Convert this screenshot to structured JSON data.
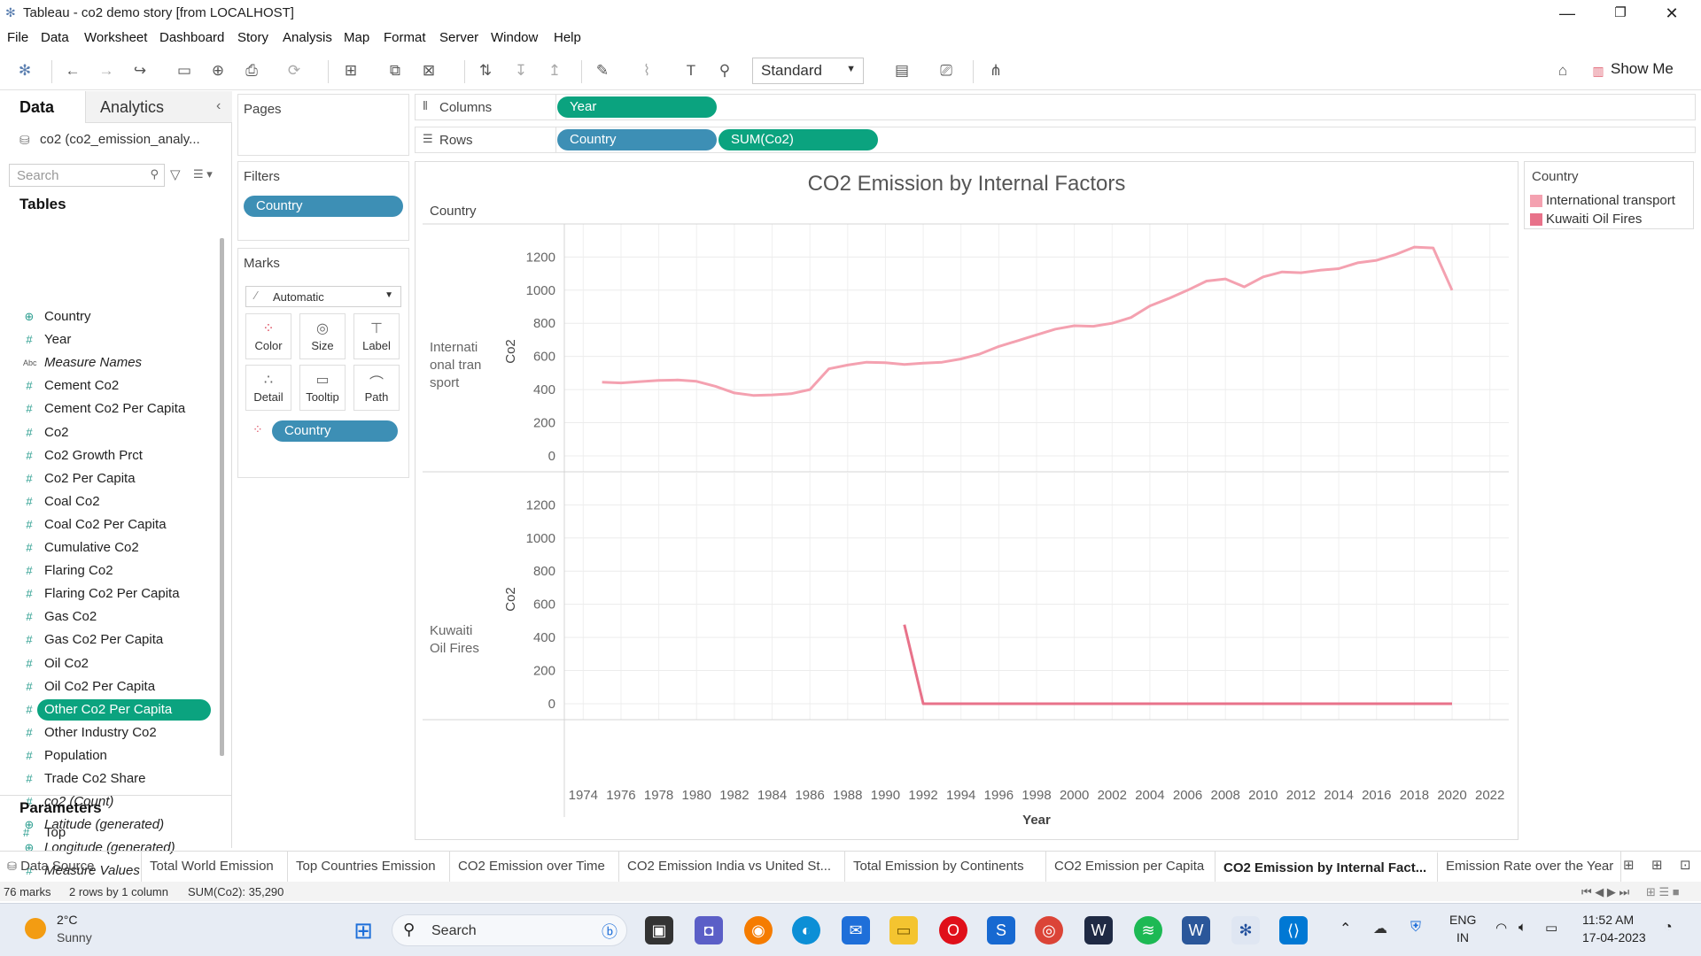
{
  "window": {
    "title": "Tableau - co2 demo story [from LOCALHOST]"
  },
  "menu": [
    "File",
    "Data",
    "Worksheet",
    "Dashboard",
    "Story",
    "Analysis",
    "Map",
    "Format",
    "Server",
    "Window",
    "Help"
  ],
  "toolbar": {
    "fit_label": "Standard",
    "show_me_label": "Show Me"
  },
  "data_pane": {
    "tab_data": "Data",
    "tab_analytics": "Analytics",
    "datasource": "co2 (co2_emission_analy...",
    "search_placeholder": "Search",
    "tables_header": "Tables",
    "fields": [
      {
        "label": "Country",
        "icon": "globe",
        "italic": false
      },
      {
        "label": "Year",
        "icon": "#",
        "italic": false
      },
      {
        "label": "Measure Names",
        "icon": "Abc",
        "italic": true
      },
      {
        "label": "Cement Co2",
        "icon": "#",
        "italic": false
      },
      {
        "label": "Cement Co2 Per Capita",
        "icon": "#",
        "italic": false
      },
      {
        "label": "Co2",
        "icon": "#",
        "italic": false
      },
      {
        "label": "Co2 Growth Prct",
        "icon": "#",
        "italic": false
      },
      {
        "label": "Co2 Per Capita",
        "icon": "#",
        "italic": false
      },
      {
        "label": "Coal Co2",
        "icon": "#",
        "italic": false
      },
      {
        "label": "Coal Co2 Per Capita",
        "icon": "#",
        "italic": false
      },
      {
        "label": "Cumulative Co2",
        "icon": "#",
        "italic": false
      },
      {
        "label": "Flaring Co2",
        "icon": "#",
        "italic": false
      },
      {
        "label": "Flaring Co2 Per Capita",
        "icon": "#",
        "italic": false
      },
      {
        "label": "Gas Co2",
        "icon": "#",
        "italic": false
      },
      {
        "label": "Gas Co2 Per Capita",
        "icon": "#",
        "italic": false
      },
      {
        "label": "Oil Co2",
        "icon": "#",
        "italic": false
      },
      {
        "label": "Oil Co2 Per Capita",
        "icon": "#",
        "italic": false
      },
      {
        "label": "Other Co2 Per Capita",
        "icon": "#",
        "italic": false,
        "selected": true
      },
      {
        "label": "Other Industry Co2",
        "icon": "#",
        "italic": false
      },
      {
        "label": "Population",
        "icon": "#",
        "italic": false
      },
      {
        "label": "Trade Co2 Share",
        "icon": "#",
        "italic": false
      },
      {
        "label": "co2 (Count)",
        "icon": "#",
        "italic": true
      },
      {
        "label": "Latitude (generated)",
        "icon": "globe",
        "italic": true
      },
      {
        "label": "Longitude (generated)",
        "icon": "globe",
        "italic": true
      },
      {
        "label": "Measure Values",
        "icon": "#",
        "italic": true
      }
    ],
    "parameters_header": "Parameters",
    "parameters": [
      {
        "label": "Top",
        "icon": "#"
      }
    ]
  },
  "shelves": {
    "pages_label": "Pages",
    "filters_label": "Filters",
    "filter_pill": "Country",
    "marks_label": "Marks",
    "mark_type": "Automatic",
    "mark_buttons": [
      "Color",
      "Size",
      "Label",
      "Detail",
      "Tooltip",
      "Path"
    ],
    "mark_pill": "Country",
    "columns_label": "Columns",
    "rows_label": "Rows",
    "columns_pill": "Year",
    "rows_pills": [
      "Country",
      "SUM(Co2)"
    ]
  },
  "legend": {
    "title": "Country",
    "items": [
      {
        "label": "International transport",
        "color": "#f4a1b0"
      },
      {
        "label": "Kuwaiti Oil Fires",
        "color": "#e8728a"
      }
    ]
  },
  "chart_data": {
    "type": "line",
    "title": "CO2 Emission by Internal Factors",
    "row_header": "Country",
    "xlabel": "Year",
    "ylabel": "Co2",
    "xlim": [
      1973,
      2023
    ],
    "ylim": [
      -50,
      1300
    ],
    "x_ticks": [
      1974,
      1976,
      1978,
      1980,
      1982,
      1984,
      1986,
      1988,
      1990,
      1992,
      1994,
      1996,
      1998,
      2000,
      2002,
      2004,
      2006,
      2008,
      2010,
      2012,
      2014,
      2016,
      2018,
      2020,
      2022
    ],
    "y_ticks": [
      0,
      200,
      400,
      600,
      800,
      1000,
      1200
    ],
    "panels": [
      {
        "name": "International transport",
        "row_label": "International transport",
        "color": "#f4a1b0",
        "x": [
          1975,
          1976,
          1977,
          1978,
          1979,
          1980,
          1981,
          1982,
          1983,
          1984,
          1985,
          1986,
          1987,
          1988,
          1989,
          1990,
          1991,
          1992,
          1993,
          1994,
          1995,
          1996,
          1997,
          1998,
          1999,
          2000,
          2001,
          2002,
          2003,
          2004,
          2005,
          2006,
          2007,
          2008,
          2009,
          2010,
          2011,
          2012,
          2013,
          2014,
          2015,
          2016,
          2017,
          2018,
          2019,
          2020
        ],
        "y": [
          445,
          440,
          448,
          455,
          458,
          450,
          420,
          380,
          365,
          368,
          375,
          400,
          525,
          548,
          565,
          562,
          552,
          560,
          565,
          585,
          615,
          660,
          695,
          730,
          765,
          785,
          782,
          800,
          835,
          905,
          950,
          1000,
          1055,
          1068,
          1020,
          1080,
          1110,
          1105,
          1120,
          1130,
          1165,
          1180,
          1215,
          1260,
          1255,
          1000
        ]
      },
      {
        "name": "Kuwaiti Oil Fires",
        "row_label": "Kuwaiti Oil Fires",
        "color": "#e8728a",
        "x": [
          1991,
          1992,
          1993,
          1994,
          1995,
          1996,
          1997,
          1998,
          1999,
          2000,
          2001,
          2002,
          2003,
          2004,
          2005,
          2006,
          2007,
          2008,
          2009,
          2010,
          2011,
          2012,
          2013,
          2014,
          2015,
          2016,
          2017,
          2018,
          2019,
          2020
        ],
        "y": [
          477,
          0,
          0,
          0,
          0,
          0,
          0,
          0,
          0,
          0,
          0,
          0,
          0,
          0,
          0,
          0,
          0,
          0,
          0,
          0,
          0,
          0,
          0,
          0,
          0,
          0,
          0,
          0,
          0,
          0
        ]
      }
    ]
  },
  "sheet_tabs": {
    "data_source": "Data Source",
    "tabs": [
      "Total World Emission",
      "Top Countries Emission",
      "CO2 Emission over Time",
      "CO2 Emission India vs United St...",
      "Total Emission by Continents",
      "CO2 Emission per Capita",
      "CO2 Emission by Internal Fact...",
      "Emission Rate over the Year"
    ],
    "active_index": 6
  },
  "status": {
    "marks": "76 marks",
    "rows_cols": "2 rows by 1 column",
    "sum": "SUM(Co2): 35,290"
  },
  "taskbar": {
    "weather_temp": "2°C",
    "weather_desc": "Sunny",
    "search_label": "Search",
    "lang_top": "ENG",
    "lang_bottom": "IN",
    "time": "11:52 AM",
    "date": "17-04-2023"
  }
}
